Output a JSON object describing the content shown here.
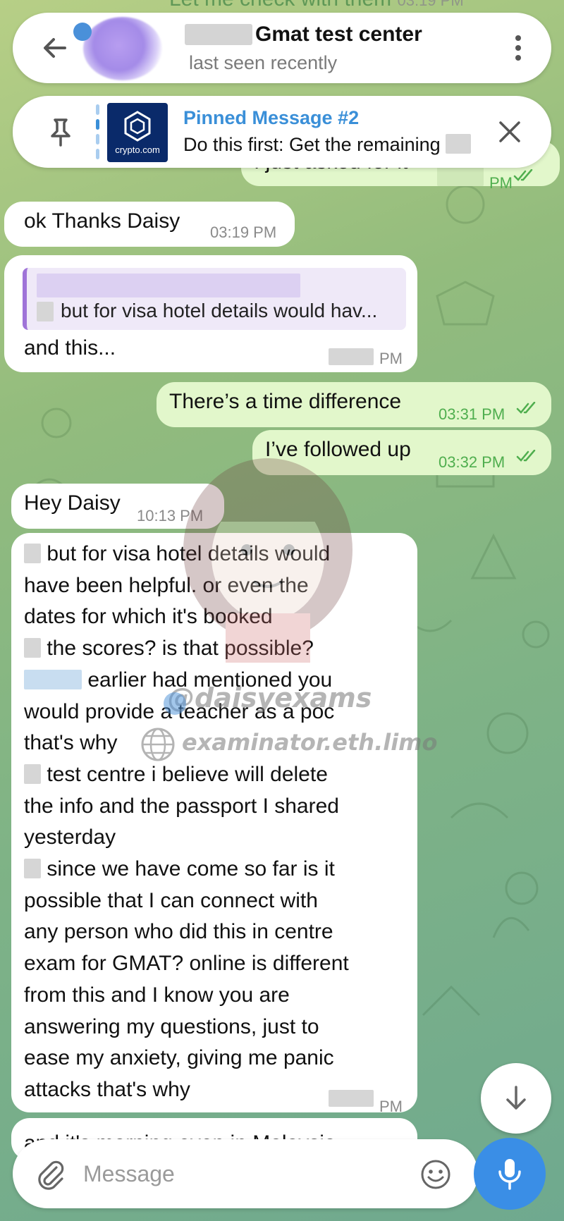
{
  "header": {
    "title": "Gmat test center",
    "status": "last seen recently"
  },
  "top_partial_message": "Let me check with them",
  "top_partial_time": "03:19 PM",
  "pinned": {
    "title": "Pinned Message #2",
    "text": "Do this first: Get the remaining",
    "logo_text": "crypto.com"
  },
  "messages": [
    {
      "id": "m1",
      "direction": "out",
      "text": "I just asked for it",
      "time": "PM",
      "read": true
    },
    {
      "id": "m2",
      "direction": "in",
      "text": "ok Thanks Daisy",
      "time": "03:19 PM"
    },
    {
      "id": "m3",
      "direction": "in",
      "reply_snippet": "but for visa hotel details would hav...",
      "text": "and this...",
      "time": "PM"
    },
    {
      "id": "m4",
      "direction": "out",
      "text": "There’s a time difference",
      "time": "03:31 PM",
      "read": true
    },
    {
      "id": "m5",
      "direction": "out",
      "text": "I’ve followed up",
      "time": "03:32 PM",
      "read": true
    },
    {
      "id": "m6",
      "direction": "in",
      "text": "Hey Daisy",
      "time": "10:13 PM"
    },
    {
      "id": "m7",
      "direction": "in",
      "time": "PM",
      "lines": [
        "but for visa hotel details would",
        "have been helpful. or even the",
        "dates for which it's booked",
        "the scores? is that possible?",
        "earlier had mentioned you",
        "would provide a teacher as a poc",
        "that's why",
        "test centre i believe will delete",
        "the info and the passport I shared",
        "yesterday",
        "since we have come so far is it",
        "possible that I can connect with",
        "any person who did this in centre",
        "exam for GMAT? online is different",
        "from this and I know you are",
        "answering my questions, just to",
        "ease my anxiety, giving me panic",
        "attacks that's why"
      ]
    },
    {
      "id": "m8",
      "direction": "in",
      "text": "and it's morning even in Malaysia"
    }
  ],
  "watermark": {
    "handle": "@daisyexams",
    "site": "examinator.eth.limo"
  },
  "input": {
    "placeholder": "Message"
  }
}
